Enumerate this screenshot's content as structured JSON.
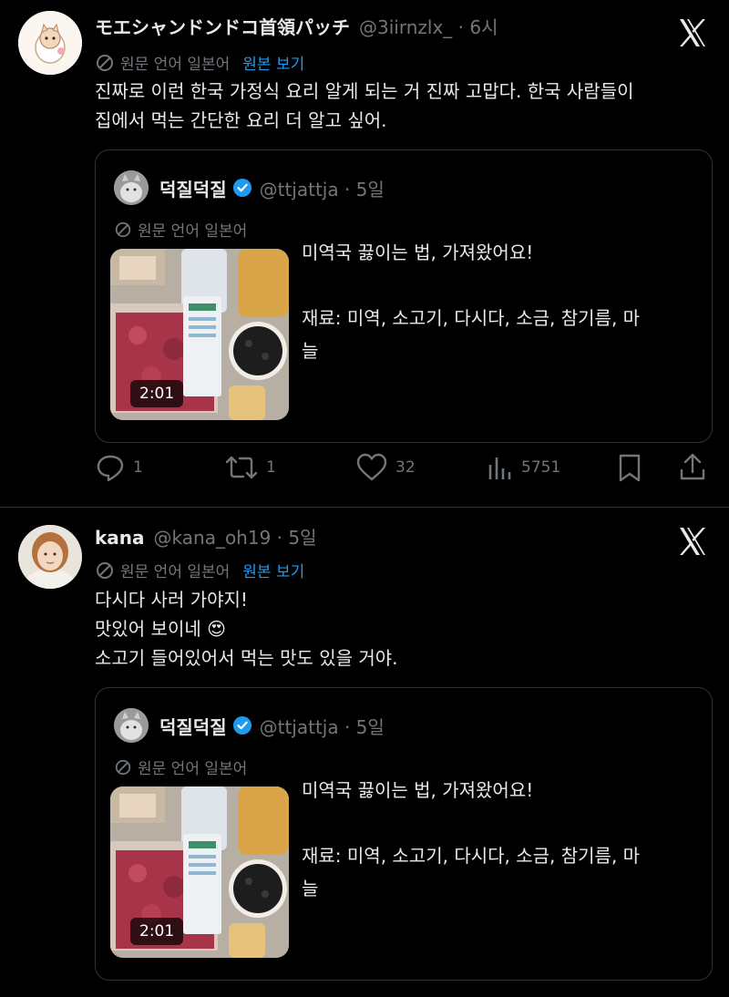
{
  "tweets": [
    {
      "author_name": "モエシャンドンドコ首領パッチ",
      "handle": "@3iirnzlx_ · 6시",
      "translation_note": "원문 언어 일본어",
      "show_original": "원본 보기",
      "text_lines": [
        "진짜로 이런 한국 가정식 요리 알게 되는 거 진짜 고맙다. 한국 사람들이",
        "집에서 먹는 간단한 요리 더 알고 싶어."
      ],
      "quote": {
        "author_name": "덕질덕질",
        "handle": "@ttjattja · 5일",
        "translation_note": "원문 언어 일본어",
        "video_duration": "2:01",
        "text_lines": [
          "미역국 끓이는 법, 가져왔어요!",
          "",
          "재료: 미역, 소고기, 다시다, 소금, 참기름, 마",
          "늘"
        ]
      },
      "actions": {
        "replies": "1",
        "reposts": "1",
        "likes": "32",
        "views": "5751"
      }
    },
    {
      "author_name": "kana",
      "handle": "@kana_oh19 · 5일",
      "translation_note": "원문 언어 일본어",
      "show_original": "원본 보기",
      "text_lines": [
        "다시다 사러 가야지!",
        "맛있어 보이네 😍",
        "소고기 들어있어서 먹는 맛도 있을 거야."
      ],
      "quote": {
        "author_name": "덕질덕질",
        "handle": "@ttjattja · 5일",
        "translation_note": "원문 언어 일본어",
        "video_duration": "2:01",
        "text_lines": [
          "미역국 끓이는 법, 가져왔어요!",
          "",
          "재료: 미역, 소고기, 다시다, 소금, 참기름, 마",
          "늘"
        ]
      }
    }
  ],
  "icons": {
    "close": "x-logo-icon",
    "translate": "translate-icon",
    "verified": "verified-badge-icon",
    "reply": "reply-icon",
    "repost": "repost-icon",
    "like": "heart-icon",
    "views": "views-icon",
    "bookmark": "bookmark-icon",
    "share": "share-icon"
  },
  "colors": {
    "background": "#000000",
    "text": "#e7e9ea",
    "muted": "#71767b",
    "link": "#1d9bf0",
    "border": "#2f3336"
  }
}
